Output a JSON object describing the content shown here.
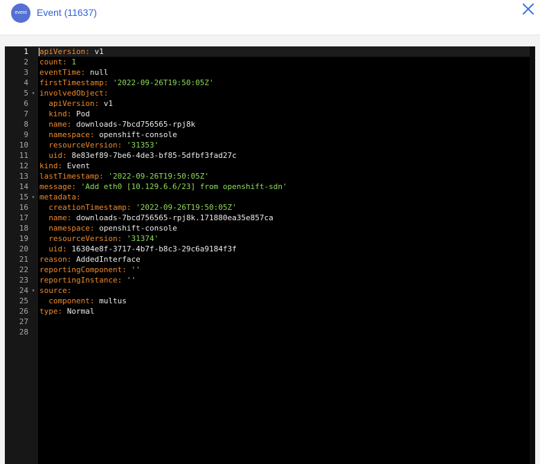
{
  "header": {
    "icon_label": "event",
    "title": "Event (11637)",
    "close_icon": "close-icon"
  },
  "editor": {
    "lines": [
      {
        "n": "1",
        "key": "apiVersion",
        "colon": ":",
        "val": " v1",
        "kind": "plain",
        "indent": "",
        "fold": ""
      },
      {
        "n": "2",
        "key": "count",
        "colon": ":",
        "val": " 1",
        "kind": "num",
        "indent": "",
        "fold": ""
      },
      {
        "n": "3",
        "key": "eventTime",
        "colon": ":",
        "val": " null",
        "kind": "plain",
        "indent": "",
        "fold": ""
      },
      {
        "n": "4",
        "key": "firstTimestamp",
        "colon": ":",
        "val": " '2022-09-26T19:50:05Z'",
        "kind": "str",
        "indent": "",
        "fold": ""
      },
      {
        "n": "5",
        "key": "involvedObject",
        "colon": ":",
        "val": "",
        "kind": "plain",
        "indent": "",
        "fold": "▾"
      },
      {
        "n": "6",
        "key": "apiVersion",
        "colon": ":",
        "val": " v1",
        "kind": "plain",
        "indent": "  ",
        "fold": ""
      },
      {
        "n": "7",
        "key": "kind",
        "colon": ":",
        "val": " Pod",
        "kind": "plain",
        "indent": "  ",
        "fold": ""
      },
      {
        "n": "8",
        "key": "name",
        "colon": ":",
        "val": " downloads-7bcd756565-rpj8k",
        "kind": "plain",
        "indent": "  ",
        "fold": ""
      },
      {
        "n": "9",
        "key": "namespace",
        "colon": ":",
        "val": " openshift-console",
        "kind": "plain",
        "indent": "  ",
        "fold": ""
      },
      {
        "n": "10",
        "key": "resourceVersion",
        "colon": ":",
        "val": " '31353'",
        "kind": "str",
        "indent": "  ",
        "fold": ""
      },
      {
        "n": "11",
        "key": "uid",
        "colon": ":",
        "val": " 8e83ef89-7be6-4de3-bf85-5dfbf3fad27c",
        "kind": "plain",
        "indent": "  ",
        "fold": ""
      },
      {
        "n": "12",
        "key": "kind",
        "colon": ":",
        "val": " Event",
        "kind": "plain",
        "indent": "",
        "fold": ""
      },
      {
        "n": "13",
        "key": "lastTimestamp",
        "colon": ":",
        "val": " '2022-09-26T19:50:05Z'",
        "kind": "str",
        "indent": "",
        "fold": ""
      },
      {
        "n": "14",
        "key": "message",
        "colon": ":",
        "val": " 'Add eth0 [10.129.6.6/23] from openshift-sdn'",
        "kind": "str",
        "indent": "",
        "fold": ""
      },
      {
        "n": "15",
        "key": "metadata",
        "colon": ":",
        "val": "",
        "kind": "plain",
        "indent": "",
        "fold": "▾"
      },
      {
        "n": "16",
        "key": "creationTimestamp",
        "colon": ":",
        "val": " '2022-09-26T19:50:05Z'",
        "kind": "str",
        "indent": "  ",
        "fold": ""
      },
      {
        "n": "17",
        "key": "name",
        "colon": ":",
        "val": " downloads-7bcd756565-rpj8k.171880ea35e857ca",
        "kind": "plain",
        "indent": "  ",
        "fold": ""
      },
      {
        "n": "18",
        "key": "namespace",
        "colon": ":",
        "val": " openshift-console",
        "kind": "plain",
        "indent": "  ",
        "fold": ""
      },
      {
        "n": "19",
        "key": "resourceVersion",
        "colon": ":",
        "val": " '31374'",
        "kind": "str",
        "indent": "  ",
        "fold": ""
      },
      {
        "n": "20",
        "key": "uid",
        "colon": ":",
        "val": " 16304e8f-3717-4b7f-b8c3-29c6a9184f3f",
        "kind": "plain",
        "indent": "  ",
        "fold": ""
      },
      {
        "n": "21",
        "key": "reason",
        "colon": ":",
        "val": " AddedInterface",
        "kind": "plain",
        "indent": "",
        "fold": ""
      },
      {
        "n": "22",
        "key": "reportingComponent",
        "colon": ":",
        "val": " ''",
        "kind": "str",
        "indent": "",
        "fold": ""
      },
      {
        "n": "23",
        "key": "reportingInstance",
        "colon": ":",
        "val": " ''",
        "kind": "str",
        "indent": "",
        "fold": ""
      },
      {
        "n": "24",
        "key": "source",
        "colon": ":",
        "val": "",
        "kind": "plain",
        "indent": "",
        "fold": "▾"
      },
      {
        "n": "25",
        "key": "component",
        "colon": ":",
        "val": " multus",
        "kind": "plain",
        "indent": "  ",
        "fold": ""
      },
      {
        "n": "26",
        "key": "type",
        "colon": ":",
        "val": " Normal",
        "kind": "plain",
        "indent": "",
        "fold": ""
      },
      {
        "n": "27",
        "key": "",
        "colon": "",
        "val": "",
        "kind": "plain",
        "indent": "",
        "fold": ""
      },
      {
        "n": "28",
        "key": "",
        "colon": "",
        "val": "",
        "kind": "plain",
        "indent": "",
        "fold": ""
      }
    ],
    "active_line": "1",
    "colors": {
      "key": "#ef8a2a",
      "string": "#8fdc5a",
      "plain": "#ececec",
      "gutter_text": "#a8a8a8",
      "background": "#000000",
      "header_title": "#2f60d8",
      "badge": "#5470d4"
    }
  }
}
